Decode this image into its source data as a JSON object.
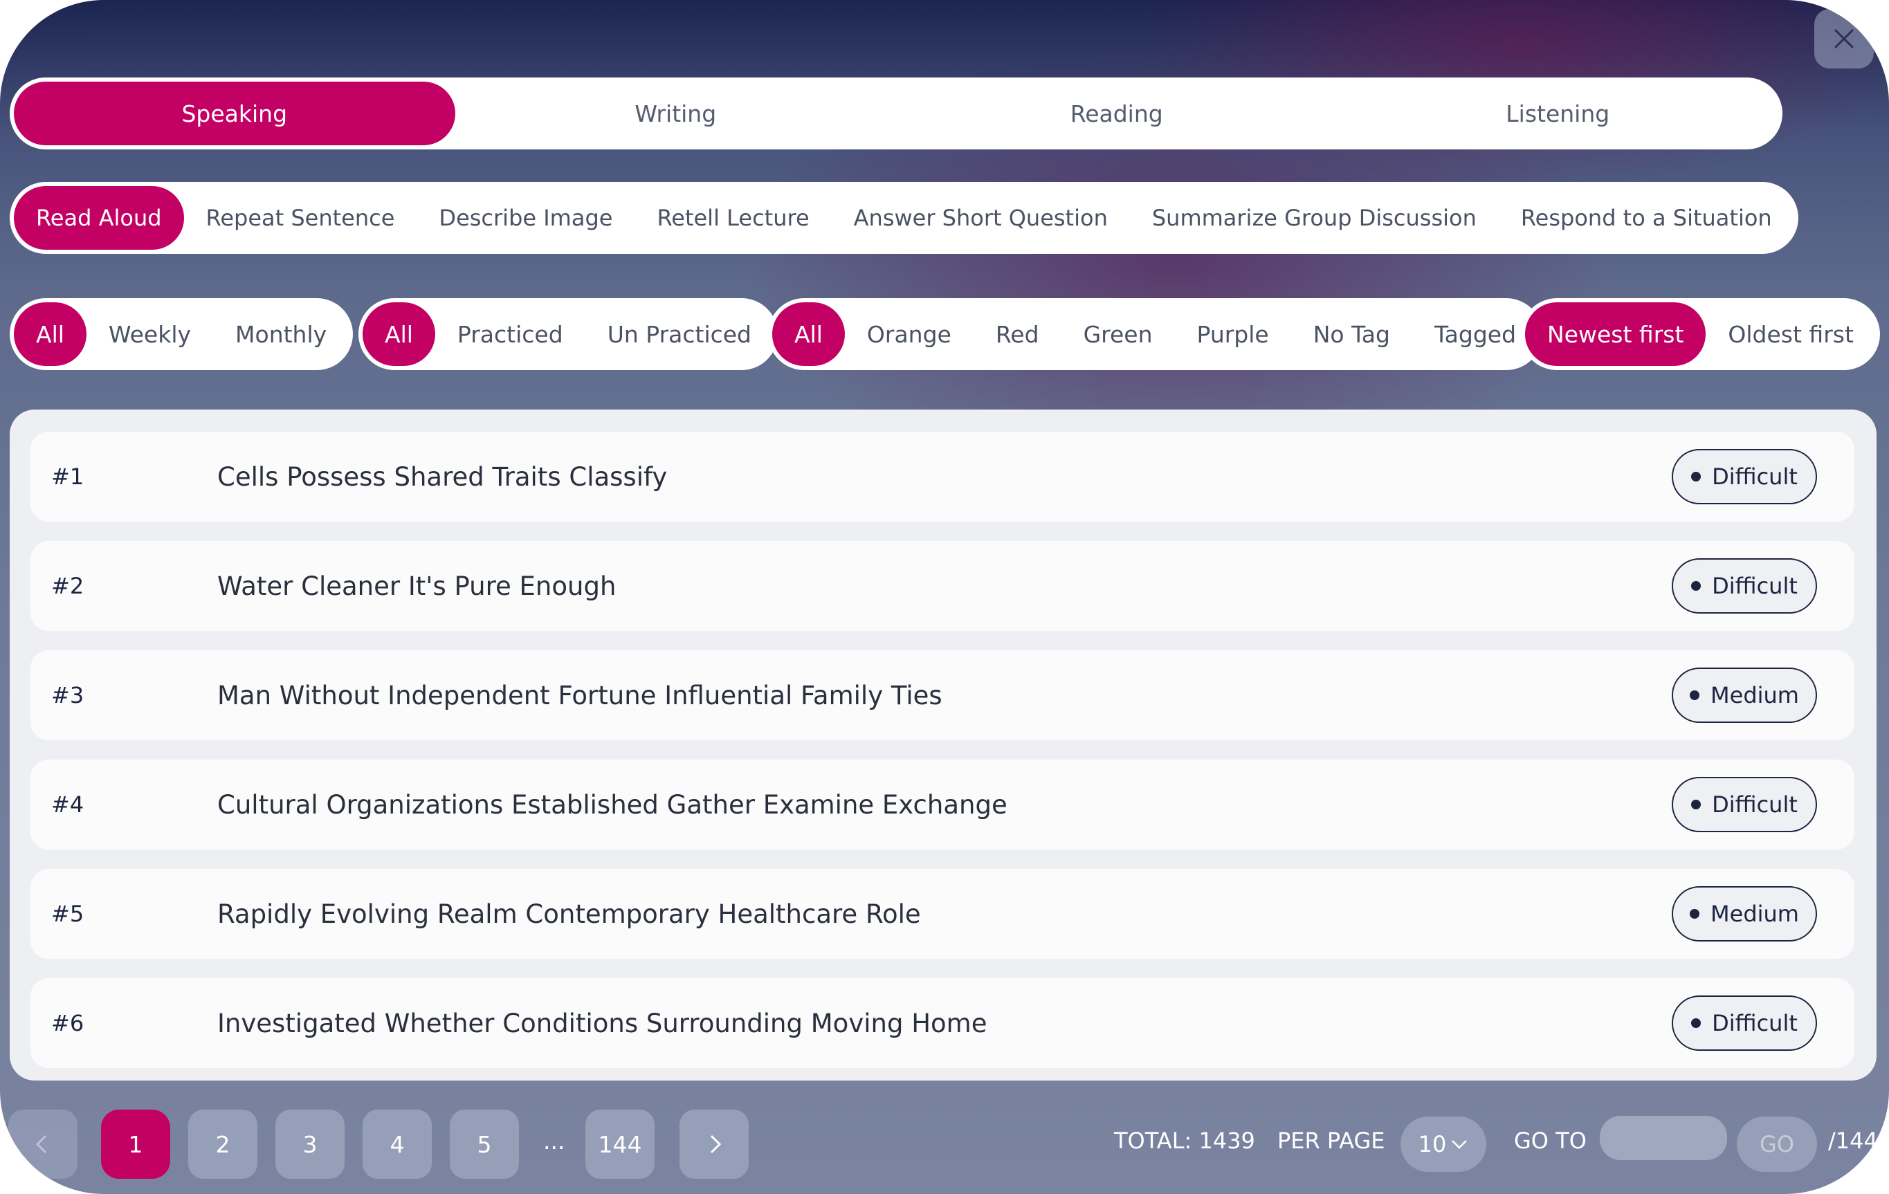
{
  "main_tabs": [
    "Speaking",
    "Writing",
    "Reading",
    "Listening"
  ],
  "sub_tabs": [
    "Read Aloud",
    "Repeat Sentence",
    "Describe Image",
    "Retell Lecture",
    "Answer Short Question",
    "Summarize Group Discussion",
    "Respond to a Situation"
  ],
  "filters": {
    "period": [
      "All",
      "Weekly",
      "Monthly"
    ],
    "practice": [
      "All",
      "Practiced",
      "Un Practiced"
    ],
    "tags": [
      "All",
      "Orange",
      "Red",
      "Green",
      "Purple",
      "No Tag",
      "Tagged"
    ],
    "sort": [
      "Newest first",
      "Oldest first"
    ]
  },
  "items": [
    {
      "num": "#1",
      "title": "Cells Possess Shared Traits Classify",
      "level": "Difficult"
    },
    {
      "num": "#2",
      "title": "Water Cleaner It's Pure Enough",
      "level": "Difficult"
    },
    {
      "num": "#3",
      "title": "Man Without Independent Fortune Influential Family Ties",
      "level": "Medium"
    },
    {
      "num": "#4",
      "title": "Cultural Organizations Established Gather Examine Exchange",
      "level": "Difficult"
    },
    {
      "num": "#5",
      "title": "Rapidly Evolving Realm Contemporary Healthcare Role",
      "level": "Medium"
    },
    {
      "num": "#6",
      "title": "Investigated Whether Conditions Surrounding Moving Home",
      "level": "Difficult"
    }
  ],
  "pagination": {
    "pages": [
      "1",
      "2",
      "3",
      "4",
      "5"
    ],
    "ellipsis": "...",
    "last_page": "144",
    "total_label": "TOTAL: 1439",
    "per_page_label": "PER PAGE",
    "per_page_value": "10",
    "goto_label": "GO TO",
    "go_button": "GO",
    "page_count": "/144"
  },
  "colors": {
    "accent": "#c30063",
    "text_dark": "#1d2440"
  }
}
